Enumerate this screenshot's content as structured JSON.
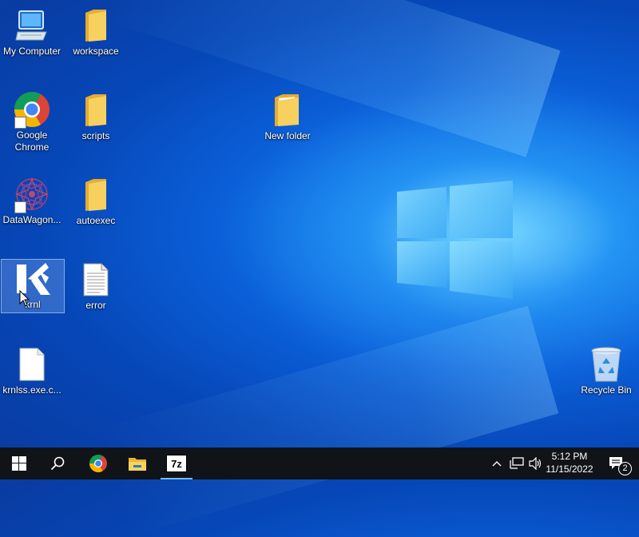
{
  "desktop": {
    "icons": {
      "my_computer": "My Computer",
      "workspace": "workspace",
      "google_chrome": "Google Chrome",
      "scripts": "scripts",
      "new_folder": "New folder",
      "datawagon": "DataWagon...",
      "autoexec": "autoexec",
      "krnl": "krnl",
      "error": "error",
      "krnlss": "krnlss.exe.c...",
      "recycle_bin": "Recycle Bin"
    }
  },
  "taskbar": {
    "apps": [
      "start-icon",
      "search-icon",
      "chrome-icon",
      "file-explorer-icon",
      "7zip-icon"
    ],
    "sevenzip_label": "7z",
    "clock_time": "5:12 PM",
    "clock_date": "11/15/2022",
    "notification_count": "2"
  },
  "colors": {
    "taskbar_bg": "#101418",
    "accent": "#76b9ed",
    "folder": "#f4c550"
  }
}
